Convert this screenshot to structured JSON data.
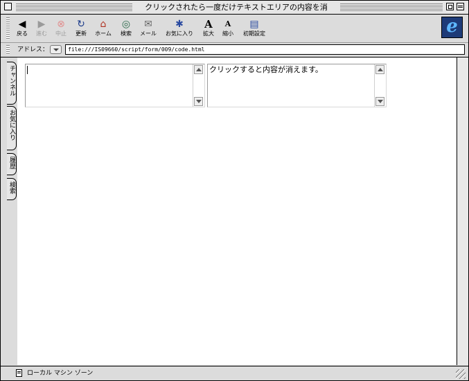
{
  "window": {
    "title": "クリックされたら一度だけテキストエリアの内容を消"
  },
  "toolbar": {
    "buttons": [
      {
        "label": "戻る",
        "icon": "back-arrow-icon"
      },
      {
        "label": "進む",
        "icon": "forward-arrow-icon",
        "disabled": true
      },
      {
        "label": "中止",
        "icon": "stop-icon",
        "disabled": true
      },
      {
        "label": "更新",
        "icon": "refresh-icon"
      },
      {
        "label": "ホーム",
        "icon": "home-icon"
      },
      {
        "label": "検索",
        "icon": "search-icon"
      },
      {
        "label": "メール",
        "icon": "mail-icon"
      },
      {
        "label": "お気に入り",
        "icon": "favorites-icon"
      },
      {
        "label": "拡大",
        "icon": "text-larger-icon"
      },
      {
        "label": "縮小",
        "icon": "text-smaller-icon"
      },
      {
        "label": "初期設定",
        "icon": "preferences-icon"
      }
    ]
  },
  "address": {
    "label": "アドレス：",
    "url": "file:///IS09660/script/form/009/code.html"
  },
  "sidetabs": [
    "チャンネル",
    "お気に入り",
    "履歴",
    "検索"
  ],
  "content": {
    "textarea1": {
      "value": ""
    },
    "textarea2": {
      "value": "クリックすると内容が消えます。"
    }
  },
  "status": {
    "zone": "ローカル マシン ゾーン"
  },
  "colors": {
    "chrome": "#dcdcdc",
    "titlebar": "#e6e6e6",
    "ie_logo_bg": "#1e3b78",
    "ie_logo_fg": "#5fb8ff"
  }
}
